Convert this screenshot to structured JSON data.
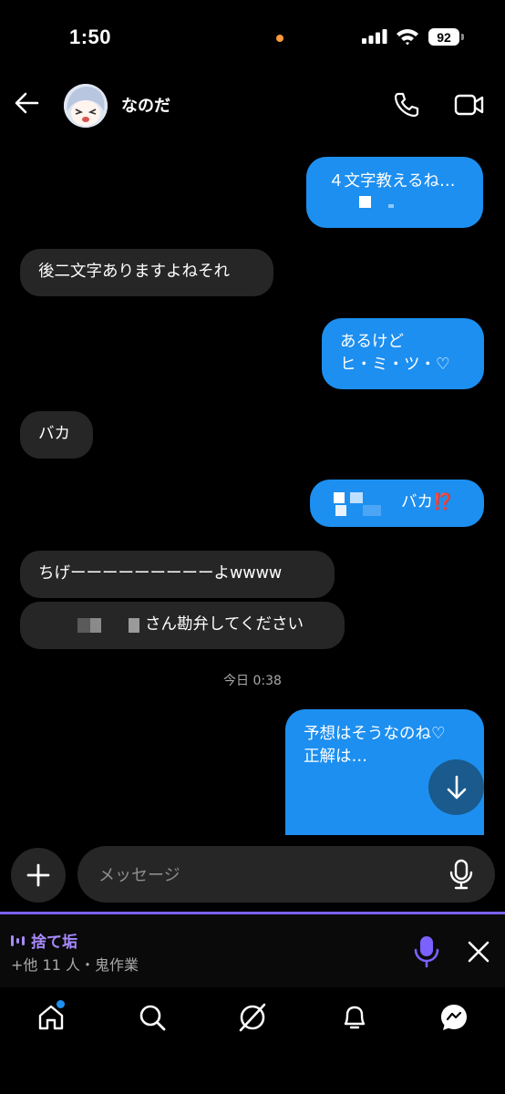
{
  "status_bar": {
    "time": "1:50",
    "battery": "92"
  },
  "header": {
    "contact_name": "なのだ"
  },
  "messages": {
    "m1": {
      "line1": "４文字教えるね…"
    },
    "m2": {
      "text": "後二文字ありますよねそれ"
    },
    "m3": {
      "line1": "あるけど",
      "line2": "ヒ・ミ・ツ・♡"
    },
    "m4": {
      "text": "バカ"
    },
    "m5": {
      "text": "バカ⁉️"
    },
    "m6": {
      "text": "ちげーーーーーーーーーよwwww"
    },
    "m7": {
      "text": "さん勘弁してください"
    },
    "m8": {
      "line1": "予想はそうなのね♡",
      "line2": "正解は…"
    }
  },
  "timestamp": "今日 0:38",
  "composer": {
    "placeholder": "メッセージ"
  },
  "call_bar": {
    "title": "捨て垢",
    "subtitle": "+他 11 人・鬼作業"
  },
  "colors": {
    "sent_bubble": "#1d8ff0",
    "received_bubble": "#262626",
    "accent_purple": "#7b61ff"
  },
  "icons": [
    "back-arrow-icon",
    "phone-icon",
    "video-camera-icon",
    "plus-icon",
    "microphone-icon",
    "close-icon",
    "home-icon",
    "search-icon",
    "explore-icon",
    "bell-icon",
    "messages-icon"
  ]
}
